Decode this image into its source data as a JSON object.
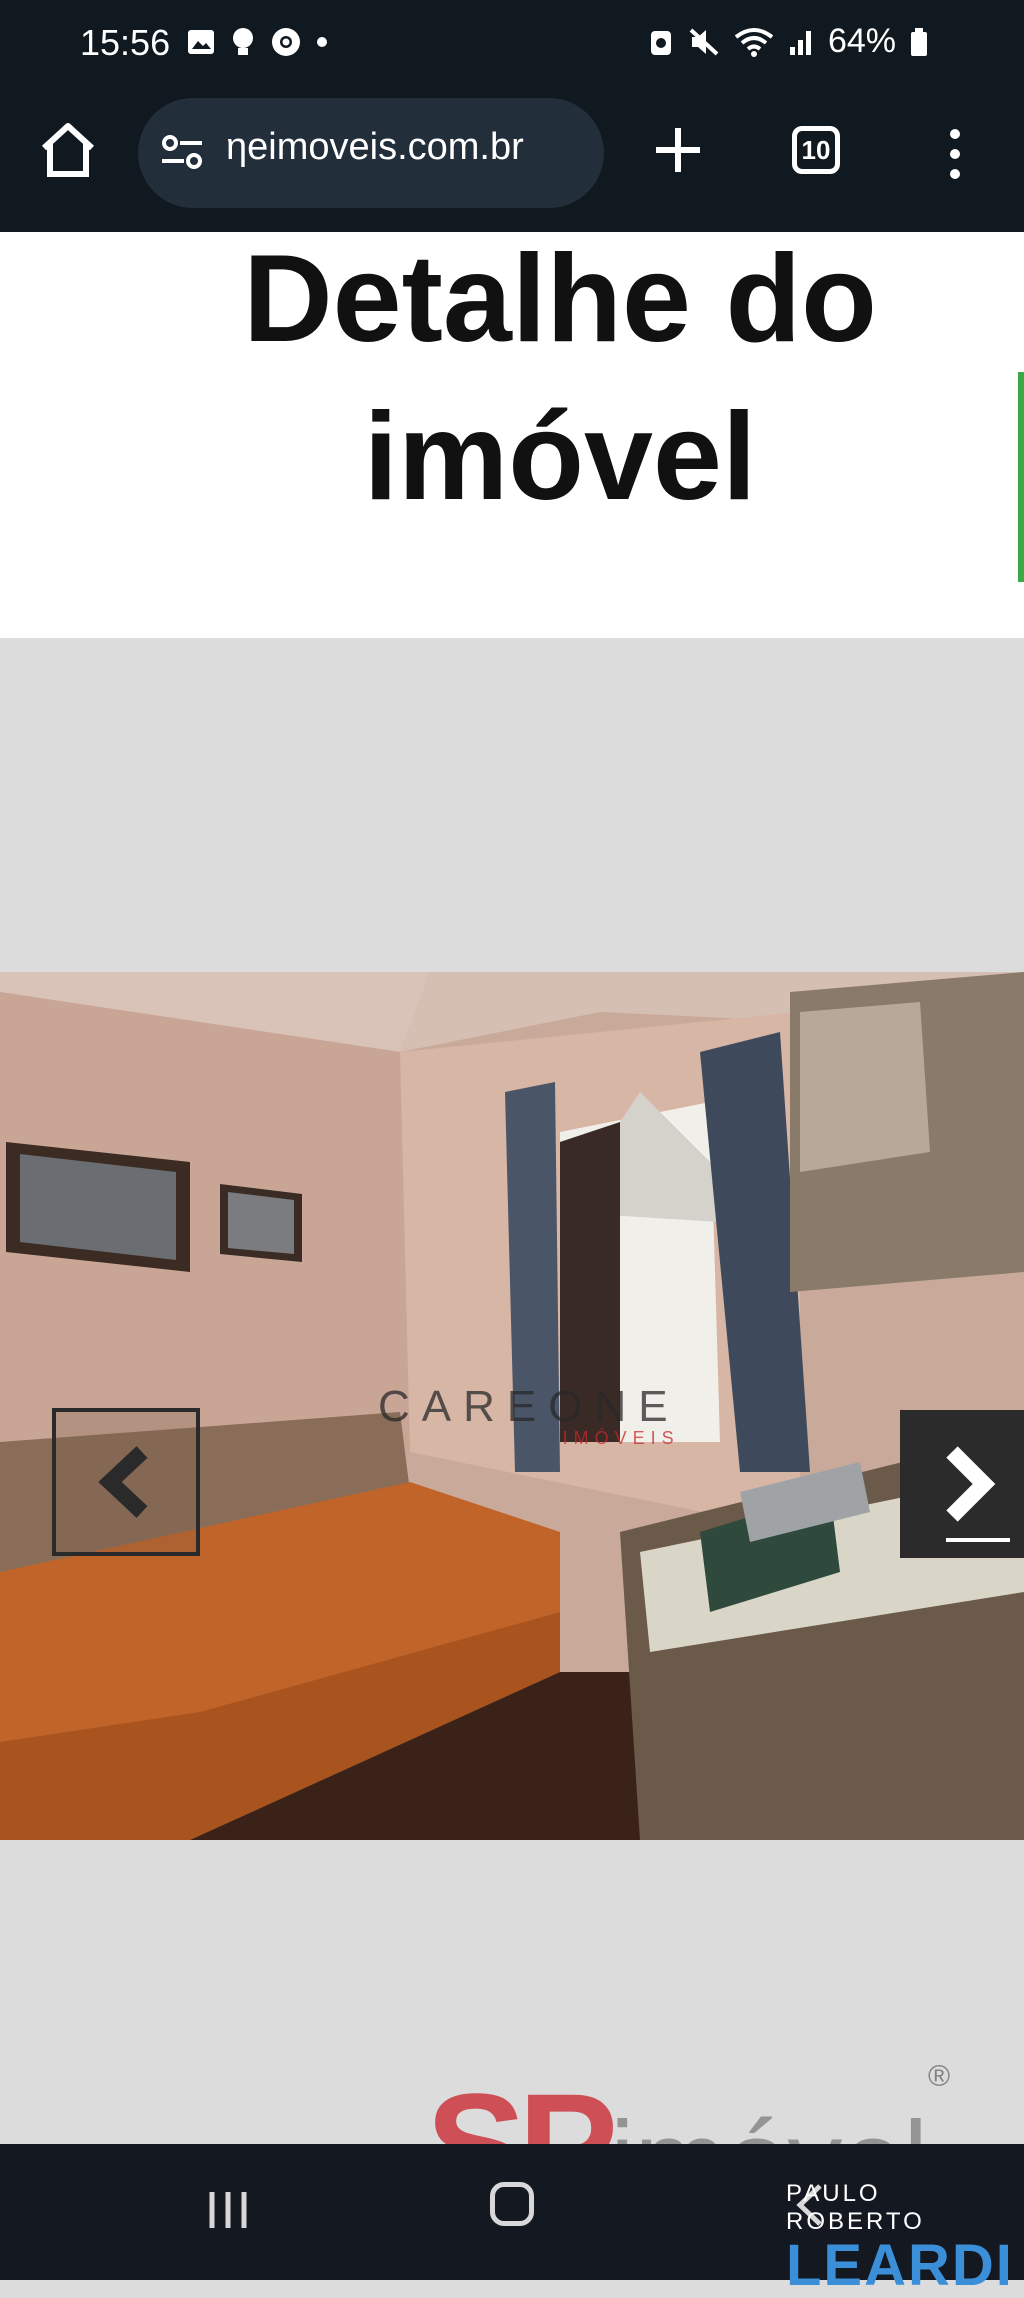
{
  "status_bar": {
    "time": "15:56",
    "battery": "64%",
    "icons": [
      "image-icon",
      "bulb-icon",
      "chrome-icon",
      "dot-icon",
      "battery-saver-icon",
      "mute-icon",
      "wifi-icon",
      "signal-icon",
      "battery-icon"
    ]
  },
  "browser": {
    "url": "ηeimoveis.com.br",
    "tab_count": "10"
  },
  "page": {
    "title_line1": "Detalhe do",
    "title_line2": "imóvel"
  },
  "gallery": {
    "watermark_brand": "CAREONE",
    "watermark_sub": "IMÓVEIS"
  },
  "logos": {
    "sp_letters": "SP",
    "sp_word": "imóvel",
    "sp_trademark": "®",
    "leardi_top": "PAULO ROBERTO",
    "leardi_name": "LEARDI"
  },
  "colors": {
    "status_bg": "#101820",
    "accent_green": "#3aa845",
    "leardi_blue": "#3b8fd8",
    "sp_red": "#c9202a"
  }
}
